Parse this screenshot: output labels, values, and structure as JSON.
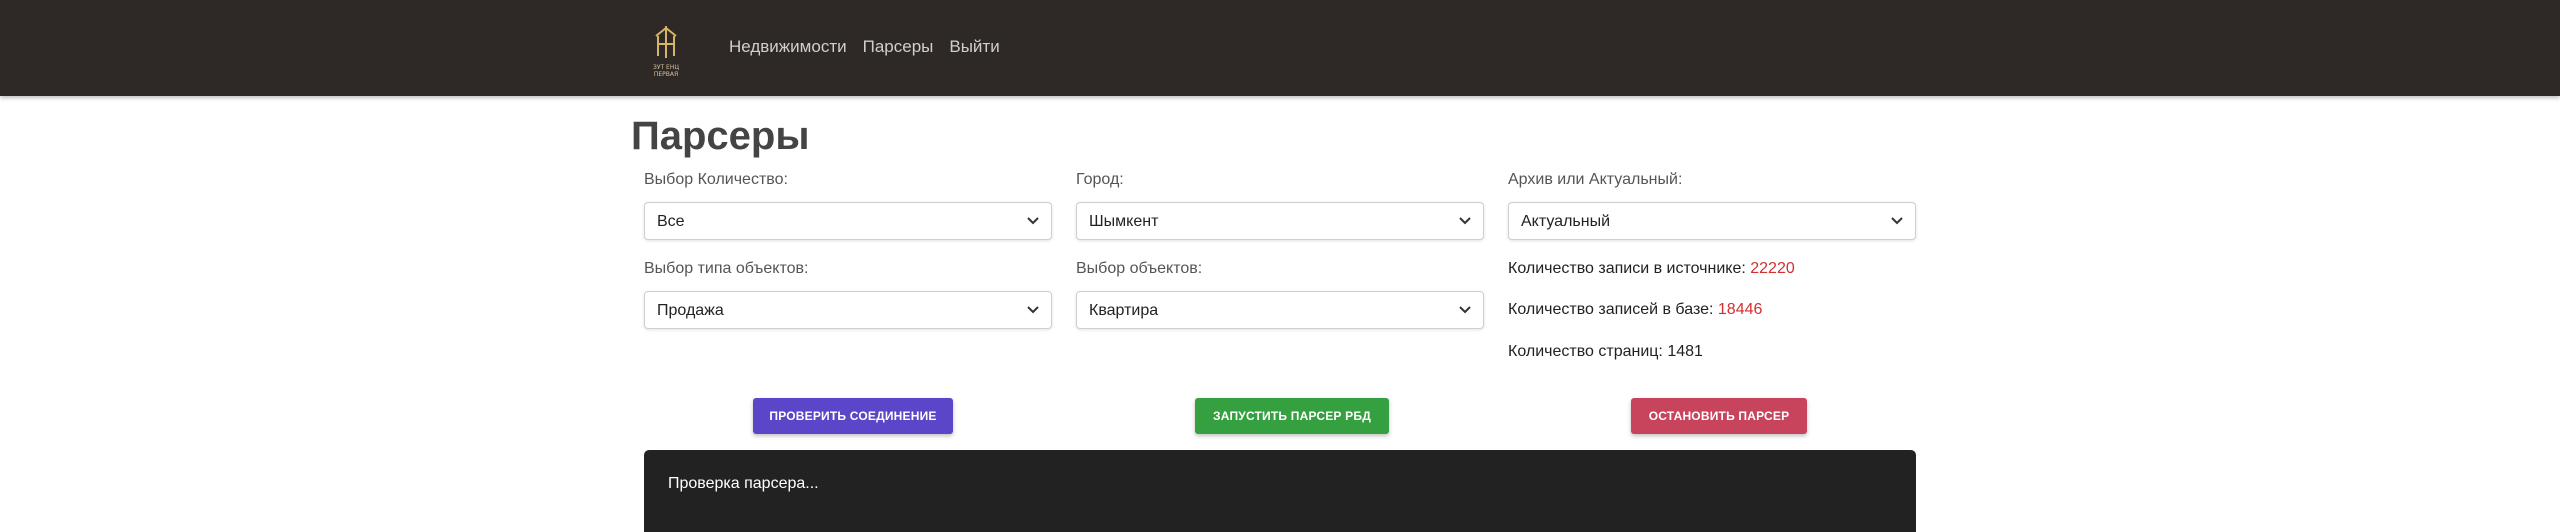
{
  "nav": {
    "logo_text_1": "ЗУТ ЕНЦ",
    "logo_text_2": "ПЕРВАЯ",
    "links": [
      "Недвижимости",
      "Парсеры",
      "Выйти"
    ]
  },
  "page": {
    "title": "Парсеры"
  },
  "filters": {
    "quantity": {
      "label": "Выбор Количество:",
      "value": "Все"
    },
    "city": {
      "label": "Город:",
      "value": "Шымкент"
    },
    "archive": {
      "label": "Архив или Актуальный:",
      "value": "Актуальный"
    },
    "object_type": {
      "label": "Выбор типа объектов:",
      "value": "Продажа"
    },
    "objects": {
      "label": "Выбор объектов:",
      "value": "Квартира"
    }
  },
  "stats": {
    "source_label": "Количество записи в источнике:",
    "source_value": "22220",
    "db_label": "Количество записей в базе:",
    "db_value": "18446",
    "pages_label": "Количество страниц:",
    "pages_value": "1481"
  },
  "buttons": {
    "check": "ПРОВЕРИТЬ СОЕДИНЕНИЕ",
    "start": "ЗАПУСТИТЬ ПАРСЕР РБД",
    "stop": "ОСТАНОВИТЬ ПАРСЕР"
  },
  "console": {
    "text": "Проверка парсера..."
  },
  "colors": {
    "navbar": "#2e2926",
    "check_button": "#5b45c9",
    "start_button": "#34a040",
    "stop_button": "#c8435c",
    "highlight": "#d32f2f",
    "console": "#222222"
  }
}
